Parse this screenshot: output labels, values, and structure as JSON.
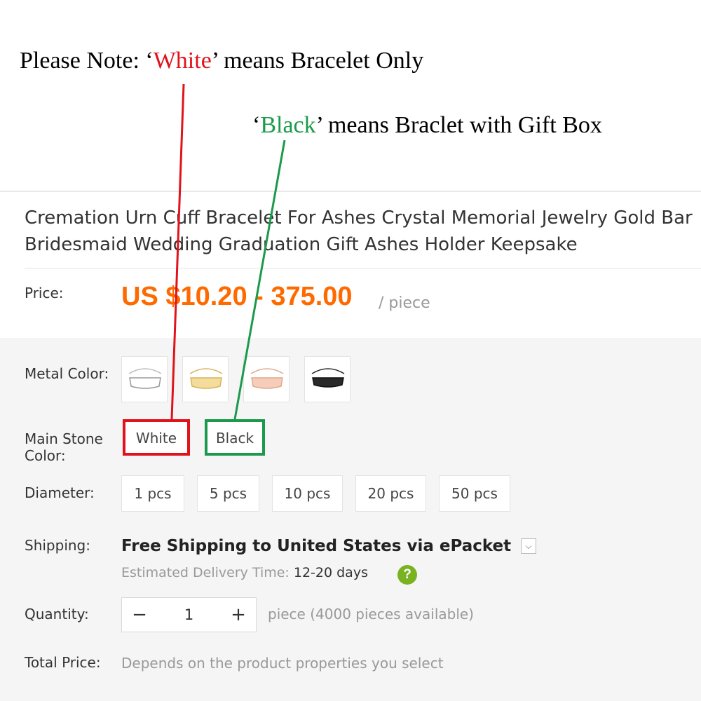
{
  "note": {
    "line1_prefix": "Please Note:  ‘",
    "line1_highlight": "White",
    "line1_suffix": "’ means Bracelet Only",
    "line2_prefix": "‘",
    "line2_highlight": "Black",
    "line2_suffix": "’ means Braclet with Gift Box"
  },
  "product": {
    "title_line1": "Cremation Urn Cuff Bracelet For Ashes Crystal Memorial Jewelry Gold Bar",
    "title_line2": "Bridesmaid Wedding Graduation Gift Ashes Holder Keepsake"
  },
  "price": {
    "label": "Price:",
    "value": "US $10.20 - 375.00",
    "unit": "/ piece"
  },
  "metal_color": {
    "label": "Metal Color:",
    "swatches": [
      {
        "name": "silver",
        "color": "#bdbdbd"
      },
      {
        "name": "gold",
        "color": "#d8b45a"
      },
      {
        "name": "rose-gold",
        "color": "#e2a88c"
      },
      {
        "name": "black",
        "color": "#2a2a2a"
      }
    ]
  },
  "main_stone_color": {
    "label_line1": "Main Stone",
    "label_line2": "Color:",
    "options": [
      "White",
      "Black"
    ]
  },
  "diameter": {
    "label": "Diameter:",
    "options": [
      "1 pcs",
      "5 pcs",
      "10 pcs",
      "20 pcs",
      "50 pcs"
    ]
  },
  "shipping": {
    "label": "Shipping:",
    "prefix": "Free Shipping to ",
    "destination": "United States",
    "via": " via ",
    "method": "ePacket",
    "est_label": "Estimated Delivery Time: ",
    "est_days": "12-20 days",
    "help": "?"
  },
  "quantity": {
    "label": "Quantity:",
    "minus": "−",
    "value": "1",
    "plus": "+",
    "available": "piece (4000 pieces available)"
  },
  "total": {
    "label": "Total Price:",
    "value": "Depends on the product properties you select"
  },
  "colors": {
    "price": "#ff6a00",
    "annotation_red": "#e0131b",
    "annotation_green": "#1a9a4a"
  }
}
